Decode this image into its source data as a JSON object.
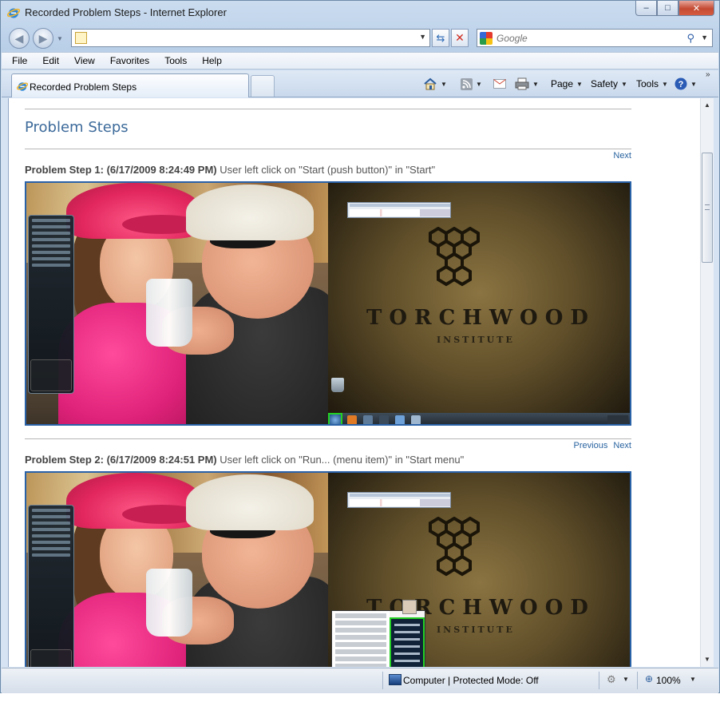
{
  "window": {
    "title": "Recorded Problem Steps - Internet Explorer",
    "controls": {
      "minimize": "‒",
      "maximize": "□",
      "close": "✕"
    }
  },
  "address_bar": {
    "url": "",
    "search_placeholder": "Google"
  },
  "menu": [
    "File",
    "Edit",
    "View",
    "Favorites",
    "Tools",
    "Help"
  ],
  "tab": {
    "label": "Recorded Problem Steps"
  },
  "command_bar": {
    "page": "Page",
    "safety": "Safety",
    "tools": "Tools"
  },
  "page": {
    "title": "Problem Steps",
    "steps": [
      {
        "heading": "Problem Step 1: (6/17/2009 8:24:49 PM)",
        "description": "User left click on \"Start (push button)\" in \"Start\"",
        "nav": [
          "Next"
        ]
      },
      {
        "heading": "Problem Step 2: (6/17/2009 8:24:51 PM)",
        "description": "User left click on \"Run... (menu item)\" in \"Start menu\"",
        "nav": [
          "Previous",
          "Next"
        ]
      }
    ],
    "screenshot": {
      "wallpaper_title": "TORCHWOOD",
      "wallpaper_subtitle": "INSTITUTE"
    }
  },
  "status_bar": {
    "zone": "Computer | Protected Mode: Off",
    "zoom": "100%"
  },
  "colors": {
    "link": "#2a64a0",
    "title": "#3c6a9a",
    "highlight": "#23d023",
    "screenshot_border": "#2a62a8"
  }
}
